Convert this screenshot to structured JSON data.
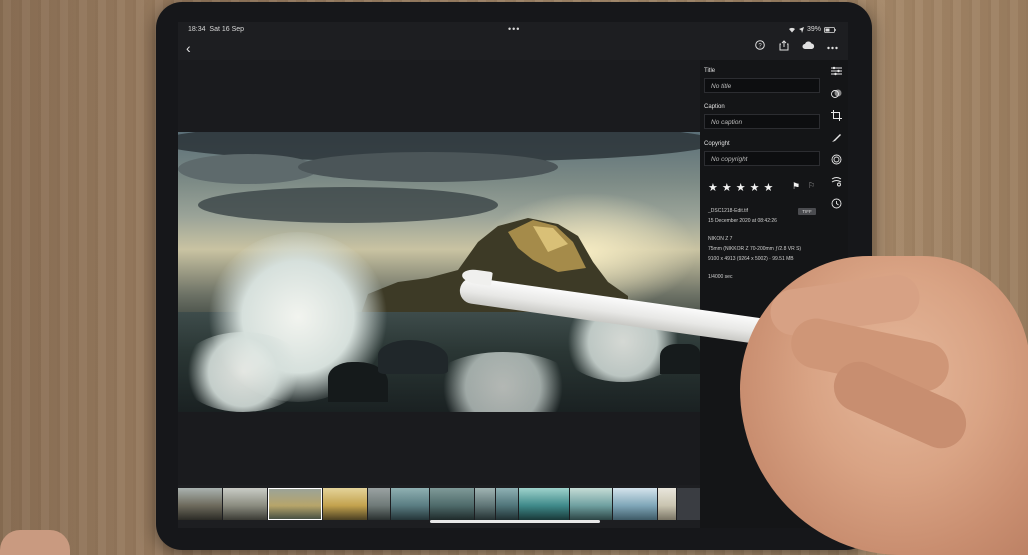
{
  "status_bar": {
    "time": "18:34",
    "date": "Sat 16 Sep",
    "more": "•••",
    "battery": "39%",
    "icons": [
      "wifi-icon",
      "location-icon",
      "battery-icon"
    ]
  },
  "top_bar": {
    "back_glyph": "‹",
    "icons": [
      "help-icon",
      "share-icon",
      "cloud-sync-icon",
      "more-icon"
    ]
  },
  "info_panel": {
    "title_label": "Title",
    "title_placeholder": "No title",
    "caption_label": "Caption",
    "caption_placeholder": "No caption",
    "copyright_label": "Copyright",
    "copyright_placeholder": "No copyright",
    "rating": 5,
    "flagged": true,
    "file_name": "_DSC1218-Edit.tif",
    "file_type_badge": "TIFF",
    "capture_date": "15 December 2020 at 08:42:26",
    "camera": "NIKON Z 7",
    "lens": "75mm (NIKKOR Z 70-200mm ƒ/2.8 VR S)",
    "dimensions": "9100 x 4913 (9264 x 5002) · 99.51 MB",
    "exposure": "1/4000 sec"
  },
  "tool_rail": {
    "top_tools": [
      "edit-sliders-icon",
      "presets-icon",
      "crop-icon",
      "brush-icon",
      "masking-icon",
      "healing-icon",
      "versions-icon"
    ],
    "bottom_tools": [
      "rating-star-icon",
      "comments-icon",
      "keywords-tag-icon",
      "info-icon"
    ]
  },
  "filmstrip": {
    "selected_index": 2,
    "thumbnails": [
      {
        "name": "coast-rock-1",
        "color": "#6d6a5c"
      },
      {
        "name": "coast-wave-2",
        "color": "#8b8c80"
      },
      {
        "name": "rock-sunrise-3",
        "color": "#b7a56a"
      },
      {
        "name": "sea-stack-4",
        "color": "#c3a24e"
      },
      {
        "name": "waves-5",
        "color": "#6f7a78"
      },
      {
        "name": "waves-6",
        "color": "#5a7d82"
      },
      {
        "name": "rocks-7",
        "color": "#4e6a6a"
      },
      {
        "name": "waves-8",
        "color": "#5f7576"
      },
      {
        "name": "waves-9",
        "color": "#50757a"
      },
      {
        "name": "wave-10",
        "color": "#3f8a8a"
      },
      {
        "name": "wave-11",
        "color": "#6fa0a0"
      },
      {
        "name": "sea-12",
        "color": "#7fa6b8"
      },
      {
        "name": "beach-13",
        "color": "#c9c4b0"
      },
      {
        "name": "screen-14",
        "color": "#3a3d42"
      }
    ]
  }
}
